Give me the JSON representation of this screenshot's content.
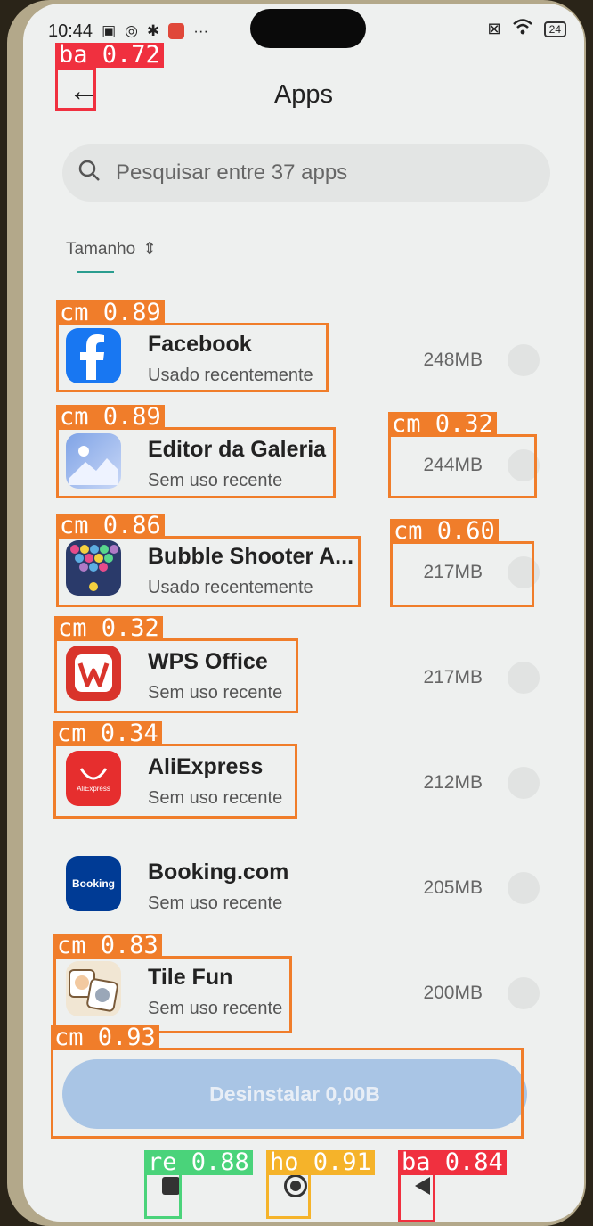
{
  "status_bar": {
    "time": "10:44",
    "battery": "24",
    "icons": [
      "nfc-icon",
      "sim-icon",
      "gear-icon",
      "app-icon",
      "more-icon",
      "no-sim-icon",
      "wifi-icon",
      "battery-icon"
    ]
  },
  "header": {
    "title": "Apps",
    "back_label": "←"
  },
  "search": {
    "placeholder": "Pesquisar entre 37 apps"
  },
  "sort": {
    "label": "Tamanho",
    "icon": "⇕"
  },
  "apps": [
    {
      "name": "Facebook",
      "status": "Usado recentemente",
      "size": "248MB",
      "icon": "facebook-icon"
    },
    {
      "name": "Editor da Galeria",
      "status": "Sem uso recente",
      "size": "244MB",
      "icon": "gallery-editor-icon"
    },
    {
      "name": "Bubble Shooter A...",
      "status": "Usado recentemente",
      "size": "217MB",
      "icon": "bubble-shooter-icon"
    },
    {
      "name": "WPS Office",
      "status": "Sem uso recente",
      "size": "217MB",
      "icon": "wps-office-icon"
    },
    {
      "name": "AliExpress",
      "status": "Sem uso recente",
      "size": "212MB",
      "icon": "aliexpress-icon"
    },
    {
      "name": "Booking.com",
      "status": "Sem uso recente",
      "size": "205MB",
      "icon": "booking-icon"
    },
    {
      "name": "Tile Fun",
      "status": "Sem uso recente",
      "size": "200MB",
      "icon": "tile-fun-icon"
    }
  ],
  "action_button": {
    "label": "Desinstalar 0,00B"
  },
  "icon_texts": {
    "booking": "Booking",
    "aliexpress": "AliExpress"
  },
  "overlay_labels": {
    "back": "ba 0.72",
    "facebook": "cm 0.89",
    "editor": "cm 0.89",
    "size244": "cm 0.32",
    "bubble": "cm 0.86",
    "size217": "cm 0.60",
    "wps": "cm 0.32",
    "aliexpress": "cm 0.34",
    "tilefun": "cm 0.83",
    "button": "cm 0.93",
    "recents": "re 0.88",
    "home": "ho 0.91",
    "navback": "ba 0.84"
  },
  "colors": {
    "accent": "#2a9d8f",
    "button": "#a9c5e5",
    "overlay_orange": "#f07d2a",
    "overlay_red": "#f0303f",
    "overlay_green": "#4ad37a",
    "overlay_yellow": "#f5b32a"
  }
}
